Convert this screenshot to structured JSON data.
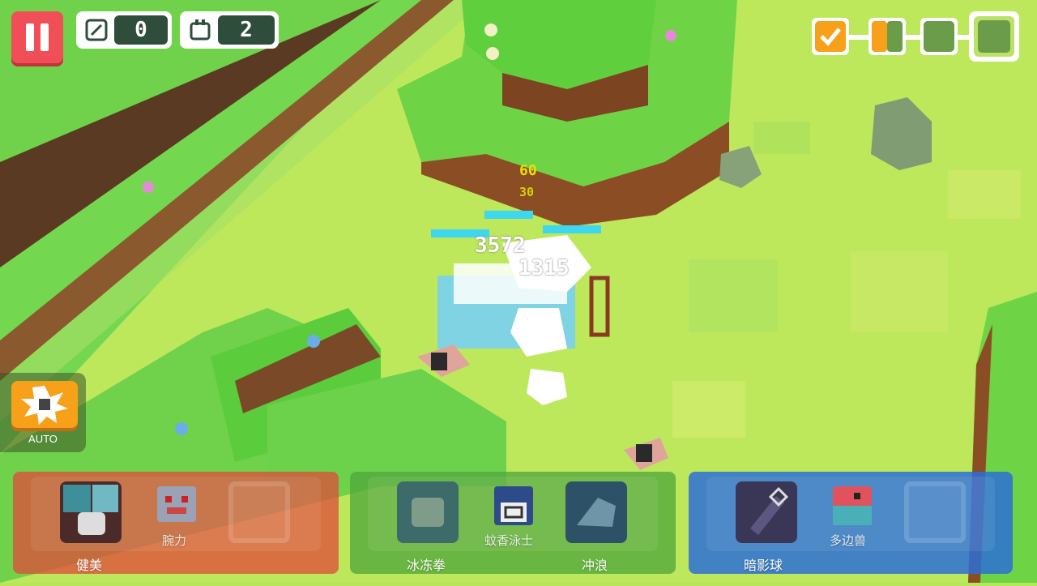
{
  "hud": {
    "pause_icon": "pause-icon",
    "attack_counter": {
      "icon": "slash-icon",
      "value": "0"
    },
    "drop_counter": {
      "icon": "bag-icon",
      "value": "2"
    },
    "wave_progress": {
      "completed": 1,
      "current": 2,
      "total": 4
    }
  },
  "battle": {
    "damage_numbers": [
      {
        "text": "60",
        "color": "#e8e000"
      },
      {
        "text": "30",
        "color": "#d8d000"
      },
      {
        "text": "3572",
        "color": "#ffffff"
      },
      {
        "text": "1315",
        "color": "#ffffff"
      }
    ]
  },
  "auto": {
    "label": "AUTO",
    "icon": "auto-burst-icon"
  },
  "team": [
    {
      "name": "健美",
      "color": "#e04a3a",
      "pokemon_label": "腕力",
      "skill_icons": [
        "shield-icon",
        "stats-icon"
      ]
    },
    {
      "name": "冰冻拳",
      "color": "#4fa53a",
      "pokemon_label": "蚊香泳士",
      "skill_name": "冲浪"
    },
    {
      "name": "暗影球",
      "color": "#2b6fd6",
      "pokemon_label": "多边兽"
    }
  ]
}
